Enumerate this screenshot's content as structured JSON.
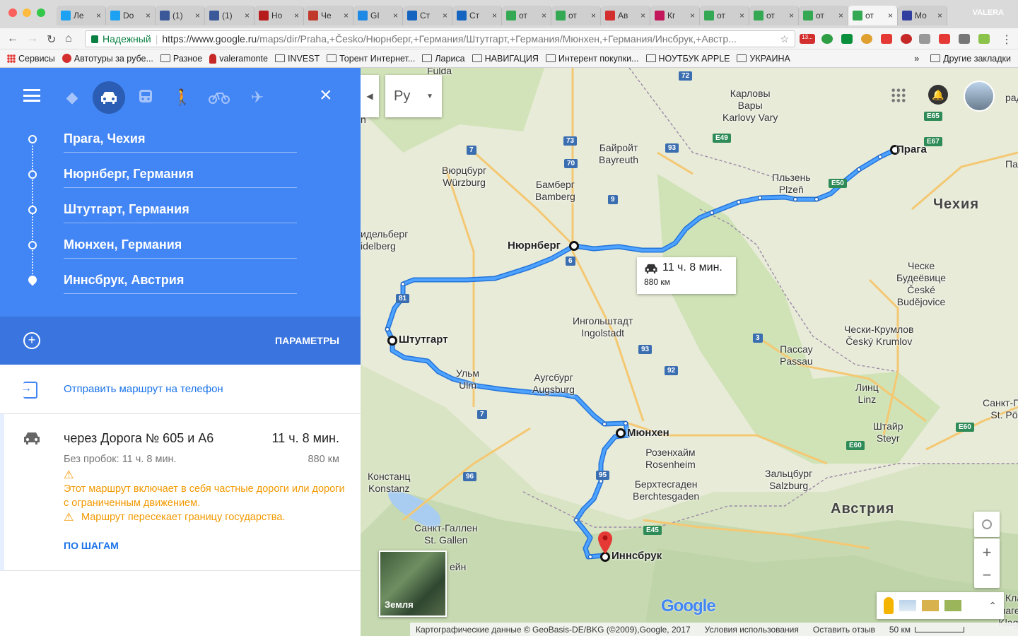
{
  "browser": {
    "tabs": [
      {
        "title": "Ле",
        "icon": "twitter-icon",
        "color": "#1da1f2"
      },
      {
        "title": "Do",
        "icon": "twitter-icon",
        "color": "#1da1f2"
      },
      {
        "title": "(1)",
        "icon": "facebook-icon",
        "color": "#3b5998"
      },
      {
        "title": "(1)",
        "icon": "facebook-icon",
        "color": "#3b5998"
      },
      {
        "title": "Но",
        "icon": "news-icon",
        "color": "#b71c1c"
      },
      {
        "title": "Че",
        "icon": "shield-icon",
        "color": "#c0392b"
      },
      {
        "title": "GI",
        "icon": "drop-icon",
        "color": "#1e88e5"
      },
      {
        "title": "Ст",
        "icon": "building-icon",
        "color": "#1565c0"
      },
      {
        "title": "Ст",
        "icon": "building-icon",
        "color": "#1565c0"
      },
      {
        "title": "от",
        "icon": "maps-icon",
        "color": "#34a853"
      },
      {
        "title": "от",
        "icon": "maps-icon",
        "color": "#34a853"
      },
      {
        "title": "Ав",
        "icon": "stop-icon",
        "color": "#d32f2f"
      },
      {
        "title": "Кг",
        "icon": "d-icon",
        "color": "#c2185b"
      },
      {
        "title": "от",
        "icon": "maps-icon",
        "color": "#34a853"
      },
      {
        "title": "от",
        "icon": "maps-icon",
        "color": "#34a853"
      },
      {
        "title": "от",
        "icon": "maps-icon",
        "color": "#34a853"
      },
      {
        "title": "от",
        "icon": "maps-icon",
        "color": "#34a853",
        "active": true
      },
      {
        "title": "Мо",
        "icon": "page-icon",
        "color": "#303f9f"
      }
    ],
    "profile": "VALERA",
    "secure_label": "Надежный",
    "url_host": "https://www.google.ru",
    "url_rest": "/maps/dir/Praha,+Česko/Нюрнберг,+Германия/Штутгарт,+Германия/Мюнхен,+Германия/Инсбрук,+Австр...",
    "ext_badge": "13..."
  },
  "bookmarks": {
    "items": [
      {
        "label": "Сервисы",
        "icon": "apps-icon"
      },
      {
        "label": "Автотуры за рубе...",
        "icon": "stop-icon"
      },
      {
        "label": "Разное",
        "icon": "folder-icon"
      },
      {
        "label": "valeramonte",
        "icon": "user-icon"
      },
      {
        "label": "INVEST",
        "icon": "folder-icon"
      },
      {
        "label": "Торент Интернет...",
        "icon": "folder-icon"
      },
      {
        "label": "Лариса",
        "icon": "folder-icon"
      },
      {
        "label": "НАВИГАЦИЯ",
        "icon": "folder-icon"
      },
      {
        "label": "Интерент покупки...",
        "icon": "folder-icon"
      },
      {
        "label": "НОУТБУК APPLE",
        "icon": "folder-icon"
      },
      {
        "label": "УКРАИНА",
        "icon": "folder-icon"
      }
    ],
    "more": "»",
    "other": "Другие закладки"
  },
  "directions": {
    "waypoints": [
      "Прага, Чехия",
      "Нюрнберг, Германия",
      "Штутгарт, Германия",
      "Мюнхен, Германия",
      "Иннсбрук, Австрия"
    ],
    "options_label": "ПАРАМЕТРЫ",
    "send_label": "Отправить маршрут на телефон",
    "route": {
      "via": "через Дорога № 605 и A6",
      "time": "11 ч. 8 мин.",
      "no_traffic": "Без пробок: 11 ч. 8 мин.",
      "distance": "880 км",
      "warning1": "Этот маршрут включает в себя частные дороги или дороги с ограниченным движением.",
      "warning2": "Маршрут пересекает границу государства.",
      "steps_label": "ПО ШАГАМ"
    }
  },
  "map": {
    "lang_button": "Ру",
    "route_label_time": "11 ч. 8 мин.",
    "route_label_dist": "880 км",
    "earth_label": "Земля",
    "footer": {
      "copyright": "Картографические данные © GeoBasis-DE/BKG (©2009),Google, 2017",
      "terms": "Условия использования",
      "feedback": "Оставить отзыв",
      "scale": "50 км"
    },
    "logo": "Google",
    "cities": [
      {
        "text": "Прага",
        "big": true
      },
      {
        "text": "Нюрнберг",
        "big": true
      },
      {
        "text": "Штутгарт",
        "big": true
      },
      {
        "text": "Мюнхен",
        "big": true
      },
      {
        "text": "Иннсбрук",
        "big": true
      },
      {
        "text": "Карловы\nВары\nKarlovy Vary"
      },
      {
        "text": "Байройт\nBayreuth"
      },
      {
        "text": "Вюрцбург\nWürzburg"
      },
      {
        "text": "Бамберг\nBamberg"
      },
      {
        "text": "Пльзень\nPlzeň"
      },
      {
        "text": "Ческе\nБудеёвице\nČeské\nBudějovice"
      },
      {
        "text": "Ингольштадт\nIngolstadt"
      },
      {
        "text": "Ульм\nUlm"
      },
      {
        "text": "Аугсбург\nAugsburg"
      },
      {
        "text": "Пассау\nPassau"
      },
      {
        "text": "Линц\nLinz"
      },
      {
        "text": "Чески-Крумлов\nČeský Krumlov"
      },
      {
        "text": "Розенхайм\nRosenheim"
      },
      {
        "text": "Зальцбург\nSalzburg"
      },
      {
        "text": "Штайр\nSteyr"
      },
      {
        "text": "Констанц\nKonstanz"
      },
      {
        "text": "Санкт-Галлен\nSt. Gallen"
      },
      {
        "text": "Берхтесгаден\nBerchtesgaden"
      },
      {
        "text": "Санкт-Пё\nSt. Pö"
      },
      {
        "text": "Клагенфурт\nKlagenfurt"
      },
      {
        "text": "Fulda"
      },
      {
        "text": "идельберг\nidelberg"
      },
      {
        "text": "рт\nn"
      },
      {
        "text": "ейн"
      },
      {
        "text": "раде"
      },
      {
        "text": "Пард"
      },
      {
        "text": "Кла"
      }
    ],
    "countries": [
      "Чехия",
      "Австрия"
    ],
    "shields": [
      "72",
      "E65",
      "E49",
      "93",
      "73",
      "70",
      "7",
      "E67",
      "E50",
      "9",
      "6",
      "81",
      "3",
      "93",
      "92",
      "7",
      "96",
      "95",
      "E45",
      "E60",
      "E60"
    ]
  }
}
